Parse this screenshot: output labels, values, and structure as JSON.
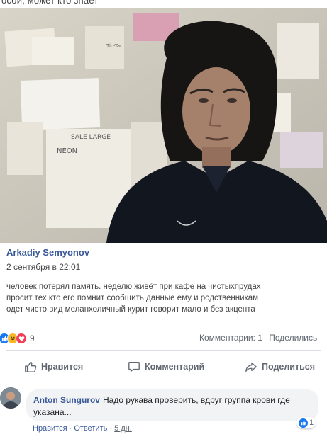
{
  "top_fragment": "осой, может кто знает",
  "post": {
    "author": "Arkadiy Semyonov",
    "timestamp": "2 сентября в 22:01",
    "text_lines": [
      "человек потерял память. неделю живёт при кафе на чистыхпрудах",
      "просит тех кто его помнит сообщить данные ему и родственникам",
      "одет чисто вид меланхоличный курит говорит мало и без акцента"
    ]
  },
  "photo": {
    "notes": [
      "SALE LARGE",
      "NEON",
      "Tic-Tac"
    ]
  },
  "reactions": {
    "icons": [
      "like-reaction",
      "haha-reaction",
      "love-reaction"
    ],
    "count": "9",
    "comments_label": "Комментарии: 1",
    "shares_label": "Поделились"
  },
  "actions": {
    "like_label": "Нравится",
    "comment_label": "Комментарий",
    "share_label": "Поделиться"
  },
  "comment": {
    "author": "Anton Sungurov",
    "text": "Надо рукава проверить, вдруг группа крови где указана...",
    "like_count": "1",
    "like_label": "Нравится",
    "reply_label": "Ответить",
    "separator": " · ",
    "time": "5 дн."
  },
  "colors": {
    "link_blue": "#385898",
    "fb_blue": "#1877f2",
    "muted": "#606770",
    "bubble": "#f2f3f5"
  }
}
